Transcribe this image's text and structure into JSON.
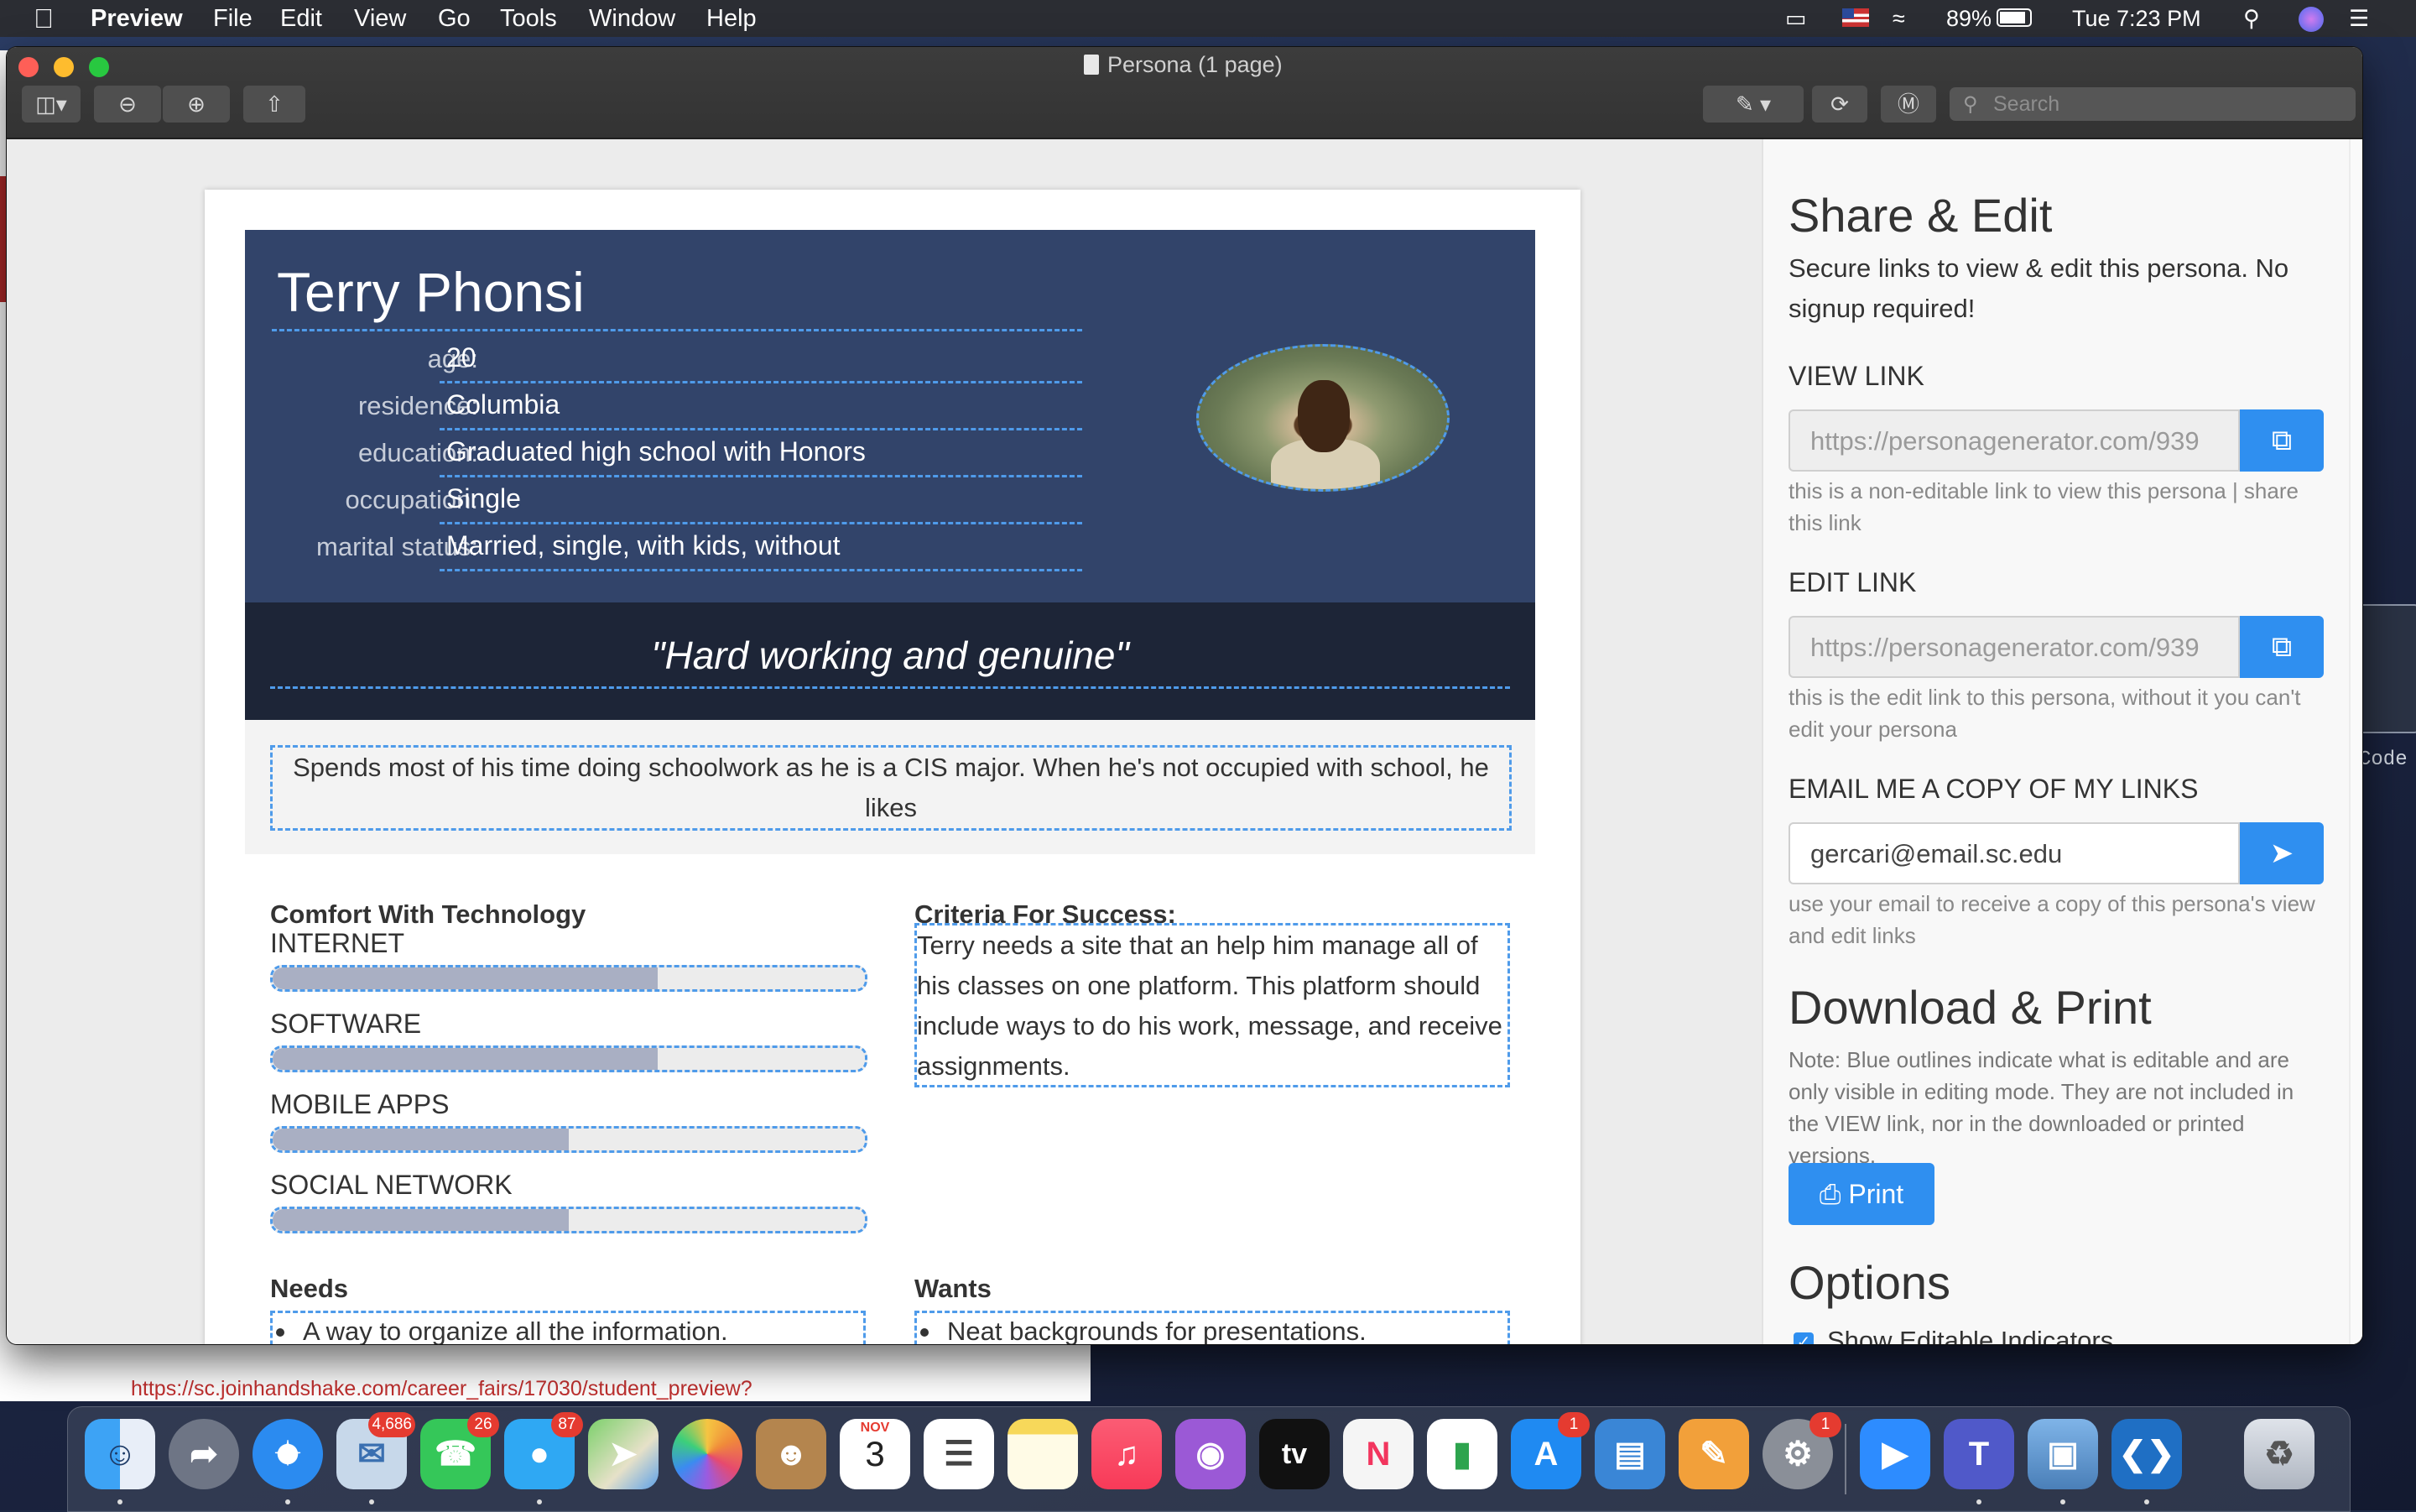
{
  "menubar": {
    "app": "Preview",
    "items": [
      "File",
      "Edit",
      "View",
      "Go",
      "Tools",
      "Window",
      "Help"
    ],
    "battery": "89%",
    "clock": "Tue 7:23 PM"
  },
  "window": {
    "title": "Persona (1 page)",
    "search_placeholder": "Search"
  },
  "persona": {
    "name": "Terry Phonsi",
    "fields": [
      {
        "label": "age:",
        "value": "20"
      },
      {
        "label": "residence:",
        "value": "Columbia"
      },
      {
        "label": "education:",
        "value": "Graduated high school with Honors"
      },
      {
        "label": "occupation:",
        "value": "Single"
      },
      {
        "label": "marital status:",
        "value": "Married, single, with kids, without"
      }
    ],
    "quote": "\"Hard working and genuine\"",
    "bio": "Spends most of his time doing schoolwork as he is a CIS major. When he's not occupied with school, he likes",
    "tech_title": "Comfort With Technology",
    "tech": [
      {
        "label": "INTERNET",
        "level": 0.65
      },
      {
        "label": "SOFTWARE",
        "level": 0.65
      },
      {
        "label": "MOBILE APPS",
        "level": 0.5
      },
      {
        "label": "SOCIAL NETWORK",
        "level": 0.5
      }
    ],
    "criteria_title": "Criteria For Success:",
    "criteria": "Terry needs a site that an help him manage all of his classes on one platform. This platform should include ways to do his work, message, and receive assignments.",
    "needs_title": "Needs",
    "needs_item": "A way to organize all the information.",
    "wants_title": "Wants",
    "wants_item": "Neat backgrounds for presentations."
  },
  "sidebar": {
    "share_title": "Share & Edit",
    "share_desc": "Secure links to view & edit this persona. No signup required!",
    "view_label": "VIEW LINK",
    "view_url": "https://personagenerator.com/939",
    "view_help": "this is a non-editable link to view this persona | share this link",
    "edit_label": "EDIT LINK",
    "edit_url": "https://personagenerator.com/939",
    "edit_help": "this is the edit link to this persona, without it you can't edit your persona",
    "email_label": "EMAIL ME A COPY OF MY LINKS",
    "email_value": "gercari@email.sc.edu",
    "email_help": "use your email to receive a copy of this persona's view and edit links",
    "download_title": "Download & Print",
    "download_note": "Note: Blue outlines indicate what is editable and are only visible in editing mode. They are not included in the VIEW link, nor in the downloaded or printed versions.",
    "print_label": "Print",
    "options_title": "Options",
    "option_label": "Show Editable Indicators"
  },
  "background": {
    "url": "https://sc.joinhandshake.com/career_fairs/17030/student_preview?",
    "side_label": "Code"
  },
  "dock": {
    "badges": {
      "mail": "4,686",
      "facetime": "26",
      "messages": "87",
      "appstore": "1",
      "settings": "1"
    },
    "calendar_month": "NOV",
    "calendar_day": "3",
    "tv_label": "tv"
  },
  "colors": {
    "accent": "#2f8ff0",
    "header_bg": "#32446a",
    "quote_bg": "#1d2537",
    "editable_outline": "#4f9bea"
  }
}
